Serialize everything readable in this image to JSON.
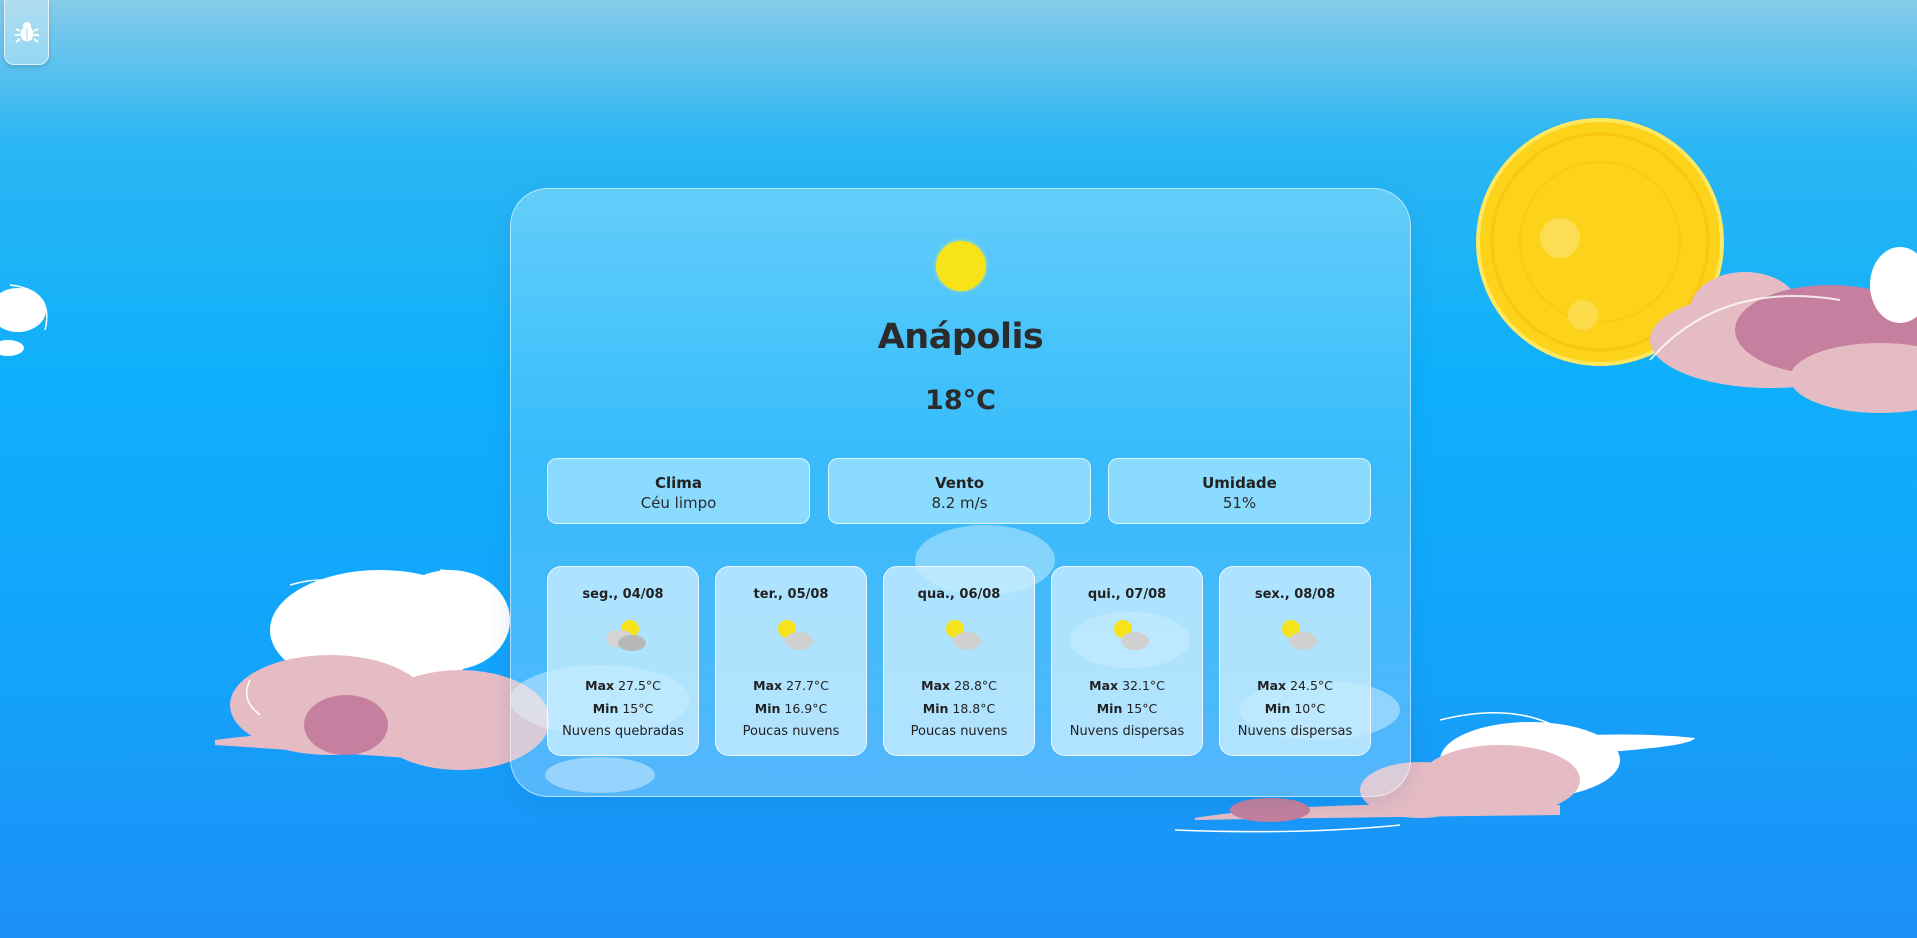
{
  "current": {
    "icon": "sun-icon",
    "city": "Anápolis",
    "temperature": "18°C"
  },
  "details": [
    {
      "label": "Clima",
      "value": "Céu limpo"
    },
    {
      "label": "Vento",
      "value": "8.2 m/s"
    },
    {
      "label": "Umidade",
      "value": "51%"
    }
  ],
  "forecast": [
    {
      "date": "seg., 04/08",
      "icon": "broken-clouds-icon",
      "max_label": "Max",
      "max": "27.5°C",
      "min_label": "Min",
      "min": "15°C",
      "desc": "Nuvens quebradas"
    },
    {
      "date": "ter., 05/08",
      "icon": "few-clouds-icon",
      "max_label": "Max",
      "max": "27.7°C",
      "min_label": "Min",
      "min": "16.9°C",
      "desc": "Poucas nuvens"
    },
    {
      "date": "qua., 06/08",
      "icon": "few-clouds-icon",
      "max_label": "Max",
      "max": "28.8°C",
      "min_label": "Min",
      "min": "18.8°C",
      "desc": "Poucas nuvens"
    },
    {
      "date": "qui., 07/08",
      "icon": "scattered-clouds-icon",
      "max_label": "Max",
      "max": "32.1°C",
      "min_label": "Min",
      "min": "15°C",
      "desc": "Nuvens dispersas"
    },
    {
      "date": "sex., 08/08",
      "icon": "scattered-clouds-icon",
      "max_label": "Max",
      "max": "24.5°C",
      "min_label": "Min",
      "min": "10°C",
      "desc": "Nuvens dispersas"
    }
  ],
  "debug": {
    "icon": "bug-icon"
  },
  "colors": {
    "sky_top": "#86cbe9",
    "sky_bottom": "#1d8ff7",
    "sun": "#f7e31a",
    "cloud_pink": "#e6bcc4",
    "cloud_mauve": "#c4809e"
  }
}
